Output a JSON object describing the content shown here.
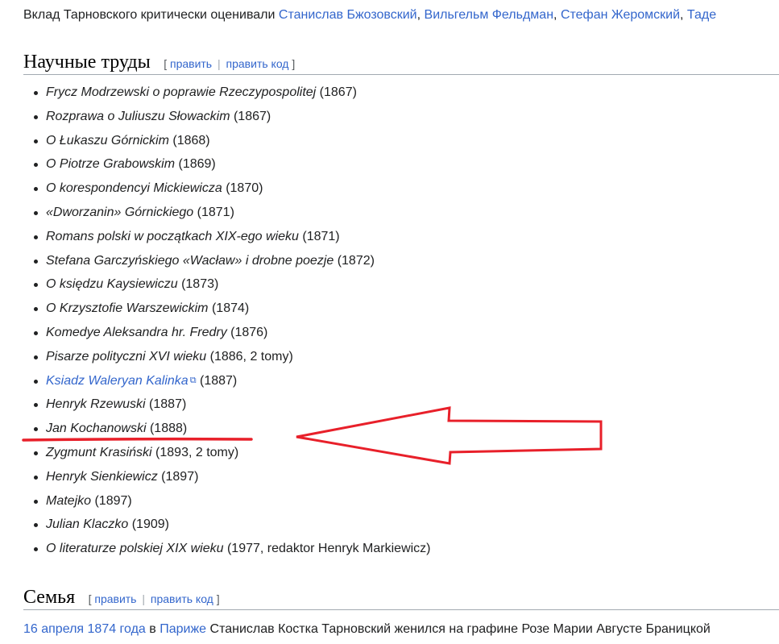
{
  "intro": {
    "prefix": "Вклад Тарновского критически оценивали ",
    "links": [
      "Станислав Бжозовский",
      "Вильгельм Фельдман",
      "Стефан Жеромский",
      "Таде"
    ],
    "sep": ", "
  },
  "sections": {
    "works": {
      "title": "Научные труды",
      "edit": "править",
      "edit_code": "править код",
      "bracket_open": "[",
      "bracket_close": "]",
      "pipe": "|"
    },
    "family": {
      "title": "Семья",
      "edit": "править",
      "edit_code": "править код",
      "bracket_open": "[",
      "bracket_close": "]",
      "pipe": "|"
    }
  },
  "works": [
    {
      "title": "Frycz Modrzewski o poprawie Rzeczypospolitej",
      "note": " (1867)"
    },
    {
      "title": "Rozprawa o Juliuszu Słowackim",
      "note": " (1867)"
    },
    {
      "title": "O Łukaszu Górnickim",
      "note": " (1868)"
    },
    {
      "title": "O Piotrze Grabowskim",
      "note": " (1869)"
    },
    {
      "title": "O korespondencyi Mickiewicza",
      "note": " (1870)"
    },
    {
      "title": "«Dworzanin» Górnickiego",
      "note": " (1871)"
    },
    {
      "title": "Romans polski w początkach XIX-ego wieku",
      "note": " (1871)"
    },
    {
      "title": "Stefana Garczyńskiego «Wacław» i drobne poezje",
      "note": " (1872)"
    },
    {
      "title": "O księdzu Kaysiewiczu",
      "note": " (1873)"
    },
    {
      "title": "O Krzysztofie Warszewickim",
      "note": " (1874)"
    },
    {
      "title": "Komedye Aleksandra hr. Fredry",
      "note": " (1876)"
    },
    {
      "title": "Pisarze polityczni XVI wieku",
      "note": " (1886, 2 tomy)"
    },
    {
      "title": "Ksiadz Waleryan Kalinka",
      "note": " (1887)",
      "link": true,
      "icon": "external-link-icon"
    },
    {
      "title": "Henryk Rzewuski",
      "note": " (1887)"
    },
    {
      "title": "Jan Kochanowski",
      "note": " (1888)"
    },
    {
      "title": "Zygmunt Krasiński",
      "note": " (1893, 2 tomy)"
    },
    {
      "title": "Henryk Sienkiewicz",
      "note": " (1897)"
    },
    {
      "title": "Matejko",
      "note": " (1897)"
    },
    {
      "title": "Julian Klaczko",
      "note": " (1909)"
    },
    {
      "title": "O literaturze polskiej XIX wieku",
      "note": " (1977, redaktor Henryk Markiewicz)"
    }
  ],
  "family_text": {
    "date_link": "16 апреля 1874 года",
    "mid": " в ",
    "place_link": "Париже",
    "rest": " Станислав Костка Тарновский женился на графине Розе Марии Августе Браницкой"
  },
  "annotation": {
    "color": "#e8202a",
    "highlighted_item": "Jan Kochanowski"
  },
  "colors": {
    "link": "#3366cc",
    "text": "#202122",
    "divider": "#a2a9b1"
  }
}
